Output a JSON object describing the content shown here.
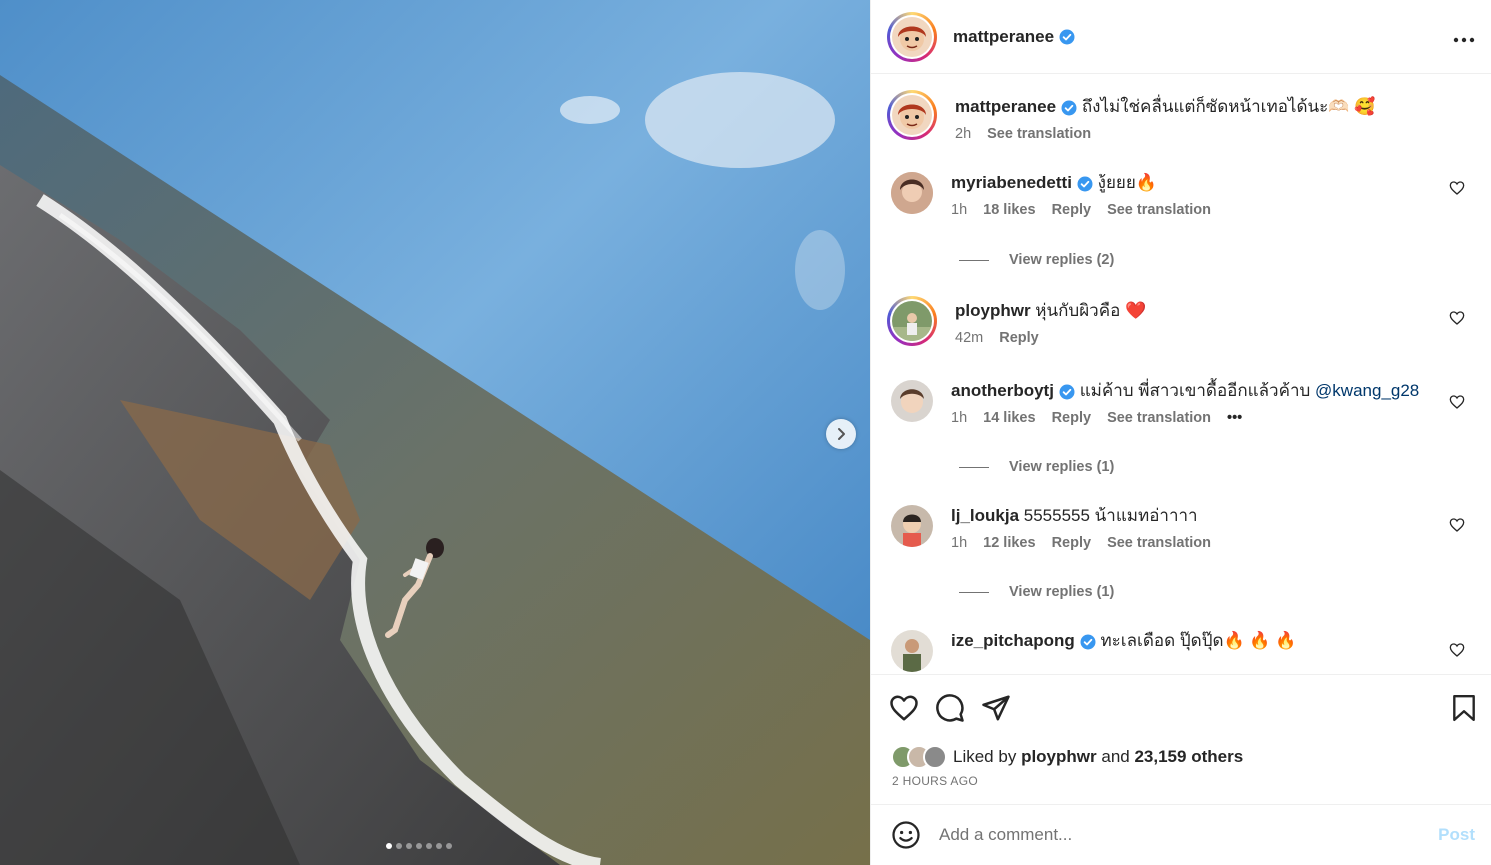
{
  "post": {
    "author": "mattperanee",
    "more_label": "•••",
    "caption_text": "ถึงไม่ใช่คลื่นแต่ก็ซัดหน้าเทอได้นะ🫶🏻 🥰",
    "caption_time": "2h",
    "caption_translate": "See translation",
    "carousel_dots": 7,
    "carousel_active": 0
  },
  "comments": [
    {
      "user": "myriabenedetti",
      "verified": true,
      "text": "งู้ยยย🔥",
      "time": "1h",
      "likes": "18 likes",
      "reply": "Reply",
      "translate": "See translation",
      "replies": "View replies (2)"
    },
    {
      "user": "ployphwr",
      "verified": false,
      "text": "หุ่นกับผิวคือ  ❤️",
      "time": "42m",
      "reply": "Reply"
    },
    {
      "user": "anotherboytj",
      "verified": true,
      "text": "แม่ค้าบ พี่สาวเขาดื้ออีกแล้วค้าบ ",
      "mention": "@kwang_g28",
      "time": "1h",
      "likes": "14 likes",
      "reply": "Reply",
      "translate": "See translation",
      "more": "•••",
      "replies": "View replies (1)"
    },
    {
      "user": "lj_loukja",
      "verified": false,
      "text": "5555555 น้าแมทอ่าาาา",
      "time": "1h",
      "likes": "12 likes",
      "reply": "Reply",
      "translate": "See translation",
      "replies": "View replies (1)"
    },
    {
      "user": "ize_pitchapong",
      "verified": true,
      "text": "ทะเลเดือด ปุ๊ดปุ๊ด🔥 🔥 🔥"
    }
  ],
  "footer": {
    "liked_prefix": "Liked by ",
    "liked_user": "ployphwr",
    "liked_and": " and ",
    "liked_count": "23,159 others",
    "timestamp": "2 HOURS AGO",
    "comment_placeholder": "Add a comment...",
    "post_label": "Post"
  },
  "colors": {
    "verified": "#3897f0",
    "post_disabled": "#b2dffc",
    "muted": "#737373"
  },
  "icons": [
    "chevron-right-icon",
    "more-icon",
    "verified-icon",
    "heart-icon",
    "comment-icon",
    "share-icon",
    "bookmark-icon",
    "emoji-icon"
  ]
}
